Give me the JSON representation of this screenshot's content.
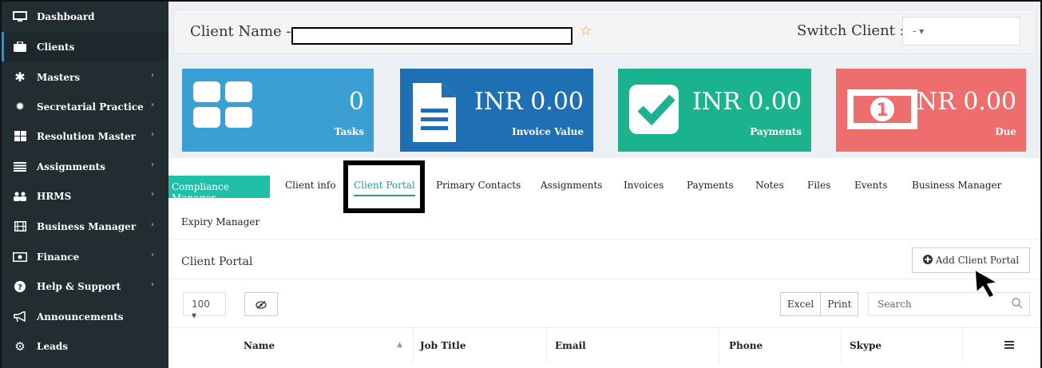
{
  "sidebar": {
    "items": [
      {
        "label": "Dashboard",
        "icon": "monitor-icon"
      },
      {
        "label": "Clients",
        "icon": "briefcase-icon",
        "active": true
      },
      {
        "label": "Masters",
        "icon": "asterisk-icon"
      },
      {
        "label": "Secretarial Practice",
        "icon": "gear-icon"
      },
      {
        "label": "Resolution Master",
        "icon": "grid-icon"
      },
      {
        "label": "Assignments",
        "icon": "list-icon"
      },
      {
        "label": "HRMS",
        "icon": "users-icon"
      },
      {
        "label": "Business Manager",
        "icon": "film-icon"
      },
      {
        "label": "Finance",
        "icon": "money-icon"
      },
      {
        "label": "Help & Support",
        "icon": "question-icon"
      },
      {
        "label": "Announcements",
        "icon": "bullhorn-icon"
      },
      {
        "label": "Leads",
        "icon": "cogs-icon"
      }
    ]
  },
  "header": {
    "client_name_label": "Client Name -",
    "switch_label": "Switch Client :",
    "switch_value": "-  ▾"
  },
  "stats": [
    {
      "value": "0",
      "label": "Tasks",
      "color": "#3c9fd4"
    },
    {
      "value": "INR 0.00",
      "label": "Invoice Value",
      "color": "#1f6fb5"
    },
    {
      "value": "INR 0.00",
      "label": "Payments",
      "color": "#1bb38e"
    },
    {
      "value": "NR 0.00",
      "label": "Due",
      "color": "#ee6e6e"
    }
  ],
  "tabs": {
    "compliance": "Compliance Manager",
    "client_info": "Client info",
    "client_portal": "Client Portal",
    "primary_contacts": "Primary Contacts",
    "assignments": "Assignments",
    "invoices": "Invoices",
    "payments": "Payments",
    "notes": "Notes",
    "files": "Files",
    "events": "Events",
    "business_manager": "Business Manager",
    "expiry_manager": "Expiry Manager"
  },
  "panel": {
    "title": "Client Portal",
    "add_button": "Add Client Portal",
    "page_length": "100  ▾",
    "excel": "Excel",
    "print": "Print",
    "search_placeholder": "Search",
    "columns": [
      "Name",
      "Job Title",
      "Email",
      "Phone",
      "Skype"
    ]
  },
  "colors": {
    "sidebar_bg": "#222d32",
    "accent_teal": "#20c0a8"
  }
}
